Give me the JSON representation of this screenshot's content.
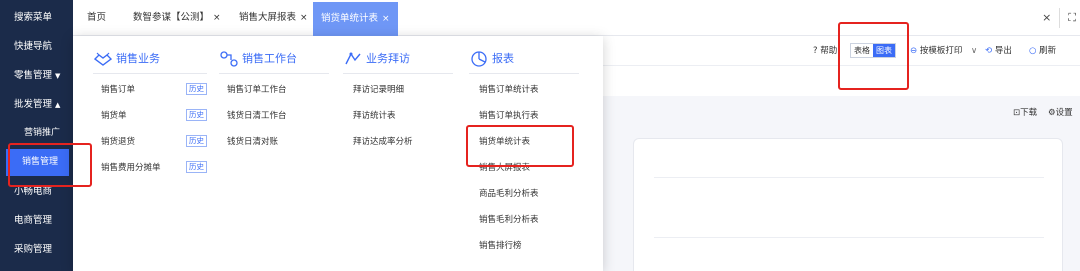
{
  "sidebar": {
    "items": [
      {
        "label": "搜索菜单"
      },
      {
        "label": "快捷导航"
      },
      {
        "label": "零售管理",
        "caret": "▼"
      },
      {
        "label": "批发管理",
        "caret": "▲"
      },
      {
        "label": "营销推广"
      },
      {
        "label": "销售管理"
      },
      {
        "label": "小畅电商"
      },
      {
        "label": "电商管理"
      },
      {
        "label": "采购管理"
      }
    ]
  },
  "tabs": [
    {
      "label": "首页"
    },
    {
      "label": "数智参谋【公测】"
    },
    {
      "label": "销售大屏报表"
    },
    {
      "label": "销货单统计表"
    }
  ],
  "close_glyph": "×",
  "tabbar_right": {
    "close": "×",
    "expand": "⛶"
  },
  "toolbar": {
    "help": "帮助",
    "view_table": "表格",
    "view_chart": "图表",
    "print": "按模板打印",
    "export": "导出",
    "refresh": "刷新"
  },
  "actions": {
    "download": "下载",
    "settings": "设置"
  },
  "menu": {
    "columns": [
      {
        "title": "销售业务",
        "icon": "handshake-icon",
        "items": [
          {
            "label": "销售订单",
            "history": "历史"
          },
          {
            "label": "销货单",
            "history": "历史"
          },
          {
            "label": "销货退货",
            "history": "历史"
          },
          {
            "label": "销售费用分摊单",
            "history": "历史"
          }
        ]
      },
      {
        "title": "销售工作台",
        "icon": "workflow-icon",
        "items": [
          {
            "label": "销售订单工作台"
          },
          {
            "label": "钱货日清工作台"
          },
          {
            "label": "钱货日清对账"
          }
        ]
      },
      {
        "title": "业务拜访",
        "icon": "visit-icon",
        "items": [
          {
            "label": "拜访记录明细"
          },
          {
            "label": "拜访统计表"
          },
          {
            "label": "拜访达成率分析"
          }
        ]
      },
      {
        "title": "报表",
        "icon": "report-icon",
        "items": [
          {
            "label": "销售订单统计表"
          },
          {
            "label": "销售订单执行表"
          },
          {
            "label": "销货单统计表"
          },
          {
            "label": "销售大屏报表"
          },
          {
            "label": "商品毛利分析表"
          },
          {
            "label": "销售毛利分析表"
          },
          {
            "label": "销售排行榜"
          }
        ]
      }
    ]
  },
  "colors": {
    "sidebar": "#1b2b4a",
    "accent": "#3b6cf6",
    "highlight": "#e5231f"
  }
}
